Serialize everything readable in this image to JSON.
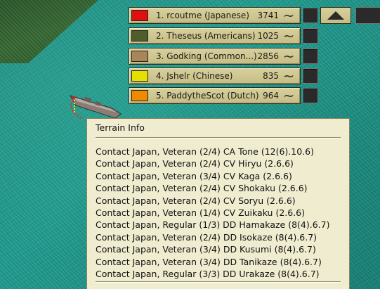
{
  "players": [
    {
      "label": "1. rcoutme (Japanese)",
      "score": "3741",
      "color": "#e01010"
    },
    {
      "label": "2. Theseus (Americans)",
      "score": "1025",
      "color": "#4e5e2a"
    },
    {
      "label": "3. Godking (Common...)",
      "score": "2856",
      "color": "#a8865a"
    },
    {
      "label": "4. Jshelr (Chinese)",
      "score": "835",
      "color": "#e6e000"
    },
    {
      "label": "5. PaddytheScot (Dutch)",
      "score": "964",
      "color": "#f08a00"
    }
  ],
  "icons": {
    "wave": "~",
    "collapse": "triangle-up-icon"
  },
  "terrain_info": {
    "title": "Terrain Info",
    "lines": [
      "Contact Japan, Veteran (2/4) CA Tone (12(6).10.6)",
      "Contact Japan, Veteran (2/4) CV Hiryu (2.6.6)",
      "Contact Japan, Veteran (3/4) CV Kaga (2.6.6)",
      "Contact Japan, Veteran (2/4) CV Shokaku (2.6.6)",
      "Contact Japan, Veteran (2/4) CV Soryu (2.6.6)",
      "Contact Japan, Veteran (1/4) CV Zuikaku (2.6.6)",
      "Contact Japan, Regular (1/3) DD Hamakaze (8(4).6.7)",
      "Contact Japan, Veteran (2/4) DD Isokaze (8(4).6.7)",
      "Contact Japan, Veteran (3/4) DD Kusumi (8(4).6.7)",
      "Contact Japan, Veteran (3/4) DD Tanikaze (8(4).6.7)",
      "Contact Japan, Regular (3/3) DD Urakaze (8(4).6.7)"
    ]
  }
}
